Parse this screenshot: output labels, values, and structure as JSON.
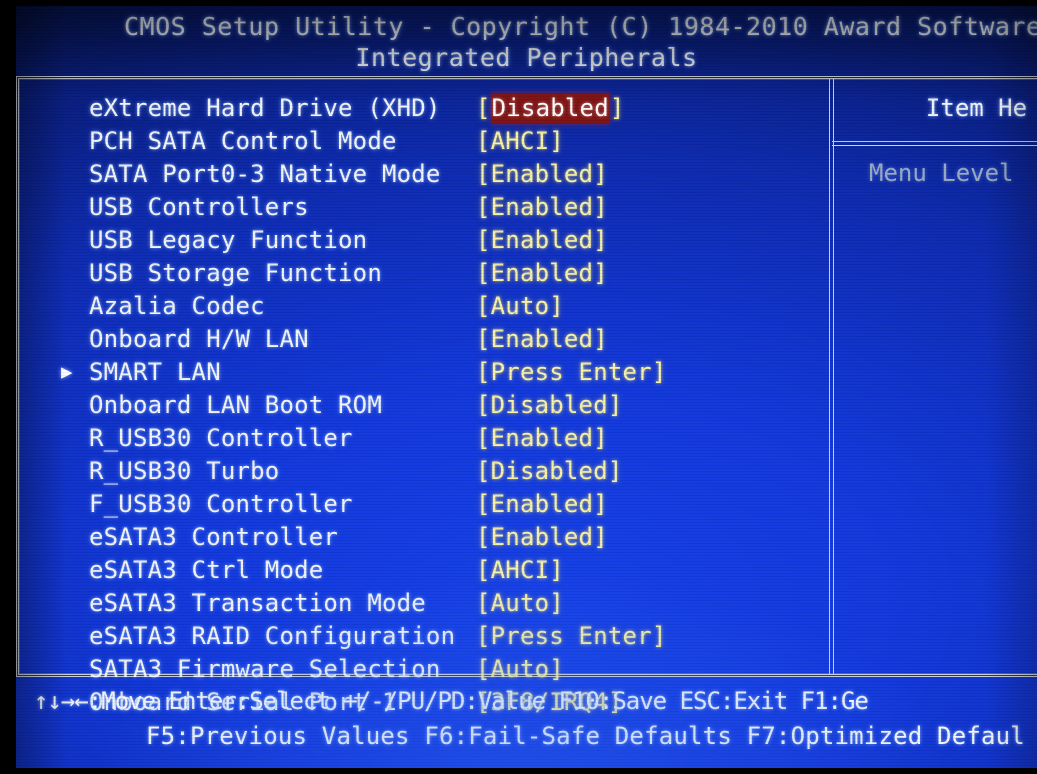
{
  "header": {
    "title": "CMOS Setup Utility - Copyright (C) 1984-2010 Award Software",
    "subtitle": "Integrated Peripherals"
  },
  "item_help": {
    "title": "Item He",
    "menu_level_label": "Menu Level"
  },
  "options": [
    {
      "arrow": "",
      "label": "eXtreme Hard Drive (XHD)",
      "value": "Disabled",
      "selected": true
    },
    {
      "arrow": "",
      "label": "PCH SATA Control Mode",
      "value": "AHCI",
      "selected": false
    },
    {
      "arrow": "",
      "label": "SATA Port0-3 Native Mode",
      "value": "Enabled",
      "selected": false
    },
    {
      "arrow": "",
      "label": "USB Controllers",
      "value": "Enabled",
      "selected": false
    },
    {
      "arrow": "",
      "label": "USB Legacy Function",
      "value": "Enabled",
      "selected": false
    },
    {
      "arrow": "",
      "label": "USB Storage Function",
      "value": "Enabled",
      "selected": false
    },
    {
      "arrow": "",
      "label": "Azalia Codec",
      "value": "Auto",
      "selected": false
    },
    {
      "arrow": "",
      "label": "Onboard H/W LAN",
      "value": "Enabled",
      "selected": false
    },
    {
      "arrow": "▶",
      "label": "SMART LAN",
      "value": "Press Enter",
      "selected": false
    },
    {
      "arrow": "",
      "label": "Onboard LAN Boot ROM",
      "value": "Disabled",
      "selected": false
    },
    {
      "arrow": "",
      "label": "R_USB30 Controller",
      "value": "Enabled",
      "selected": false
    },
    {
      "arrow": "",
      "label": "R_USB30 Turbo",
      "value": "Disabled",
      "selected": false
    },
    {
      "arrow": "",
      "label": "F_USB30 Controller",
      "value": "Enabled",
      "selected": false
    },
    {
      "arrow": "",
      "label": "eSATA3 Controller",
      "value": "Enabled",
      "selected": false
    },
    {
      "arrow": "",
      "label": "eSATA3 Ctrl Mode",
      "value": "AHCI",
      "selected": false
    },
    {
      "arrow": "",
      "label": "eSATA3 Transaction Mode",
      "value": "Auto",
      "selected": false
    },
    {
      "arrow": "",
      "label": "eSATA3 RAID Configuration",
      "value": "Press Enter",
      "selected": false
    },
    {
      "arrow": "",
      "label": "SATA3 Firmware Selection",
      "value": "Auto",
      "selected": false
    },
    {
      "arrow": "",
      "label": "Onboard Serial Port 1",
      "value": "3F8/IRQ4",
      "selected": false
    }
  ],
  "keybar": {
    "line1": "↑↓→←:Move   Enter:Select   +/-/PU/PD:Value   F10:Save   ESC:Exit   F1:Ge",
    "line2": "F5:Previous Values   F6:Fail-Safe Defaults   F7:Optimized Defaul",
    "keys": [
      {
        "key": "↑↓→←",
        "action": "Move"
      },
      {
        "key": "Enter",
        "action": "Select"
      },
      {
        "key": "+/-/PU/PD",
        "action": "Value"
      },
      {
        "key": "F10",
        "action": "Save"
      },
      {
        "key": "ESC",
        "action": "Exit"
      },
      {
        "key": "F1",
        "action": "Ge"
      },
      {
        "key": "F5",
        "action": "Previous Values"
      },
      {
        "key": "F6",
        "action": "Fail-Safe Defaults"
      },
      {
        "key": "F7",
        "action": "Optimized Defaul"
      }
    ]
  },
  "colors": {
    "background_blue": "#1238dc",
    "label_white": "#f2f4f8",
    "value_yellow": "#f6f2a8",
    "selection_red": "#7e1414",
    "frame_gray": "#cdd3de",
    "help_dim": "#9aa9c6"
  }
}
